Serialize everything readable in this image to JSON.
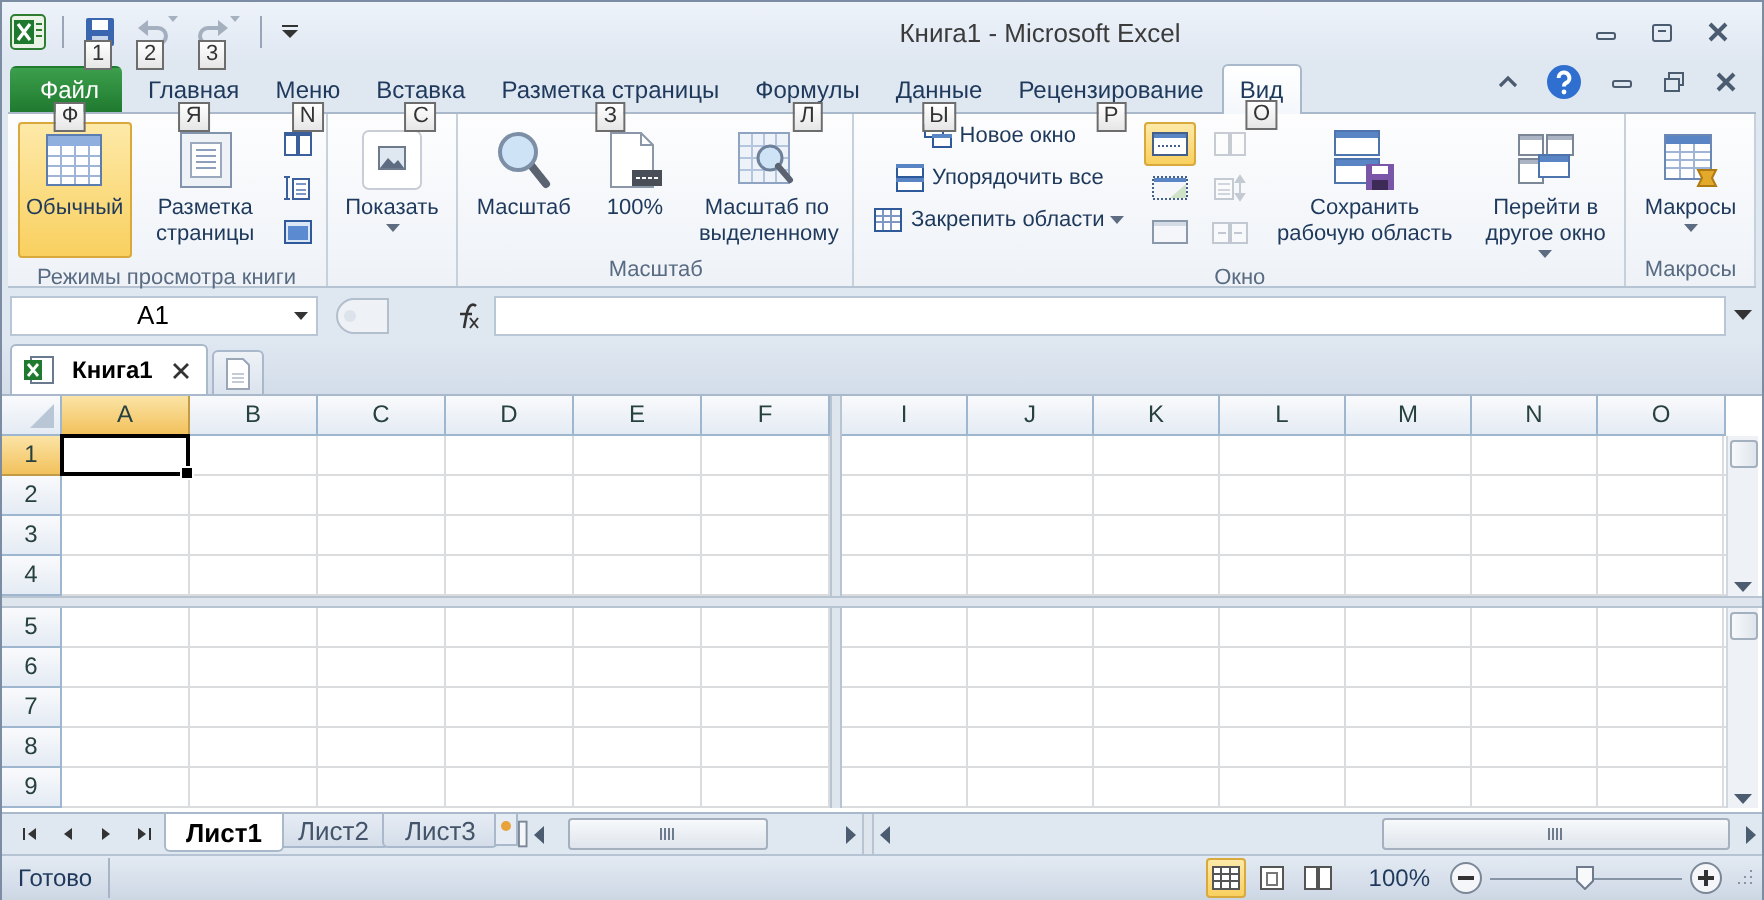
{
  "window": {
    "title": "Книга1 - Microsoft Excel"
  },
  "quick_access": [
    {
      "kind": "save",
      "key_tip": "1",
      "disabled": false
    },
    {
      "kind": "undo",
      "key_tip": "2",
      "disabled": true
    },
    {
      "kind": "redo",
      "key_tip": "3",
      "disabled": true
    }
  ],
  "tabs": [
    {
      "label": "Файл",
      "kind": "file",
      "key_tip": "Ф",
      "selected": false
    },
    {
      "label": "Главная",
      "kind": "tab",
      "key_tip": "Я",
      "selected": false
    },
    {
      "label": "Меню",
      "kind": "tab",
      "key_tip": "N",
      "selected": false
    },
    {
      "label": "Вставка",
      "kind": "tab",
      "key_tip": "С",
      "selected": false
    },
    {
      "label": "Разметка страницы",
      "kind": "tab",
      "key_tip": "З",
      "selected": false
    },
    {
      "label": "Формулы",
      "kind": "tab",
      "key_tip": "Л",
      "selected": false
    },
    {
      "label": "Данные",
      "kind": "tab",
      "key_tip": "Ы",
      "selected": false
    },
    {
      "label": "Рецензирование",
      "kind": "tab",
      "key_tip": "Р",
      "selected": false
    },
    {
      "label": "Вид",
      "kind": "tab",
      "key_tip": "О",
      "selected": true
    }
  ],
  "ribbon": {
    "groups": [
      {
        "label": "Режимы просмотра книги",
        "columns": [
          {
            "kind": "large",
            "items": [
              {
                "kind": "normal",
                "label": "Обычный",
                "selected": true
              }
            ]
          },
          {
            "kind": "large",
            "items": [
              {
                "kind": "layout",
                "label": "Разметка страницы",
                "selected": false
              }
            ]
          },
          {
            "kind": "icons",
            "items": [
              {
                "kind": "pagebreak",
                "selected": false
              },
              {
                "kind": "customviews",
                "selected": false
              },
              {
                "kind": "fullscreen",
                "selected": false
              }
            ]
          }
        ]
      },
      {
        "columns": [
          {
            "kind": "large",
            "items": [
              {
                "kind": "show",
                "label": "Показать",
                "dropdown": true
              }
            ]
          }
        ]
      },
      {
        "label": "Масштаб",
        "columns": [
          {
            "kind": "large",
            "items": [
              {
                "kind": "zoom",
                "label": "Масштаб"
              }
            ]
          },
          {
            "kind": "large",
            "items": [
              {
                "kind": "zoom100",
                "label": "100%"
              }
            ]
          },
          {
            "kind": "large",
            "items": [
              {
                "kind": "zoomselection",
                "label": "Масштаб по выделенному"
              }
            ]
          }
        ]
      },
      {
        "label": "Окно",
        "columns": [
          {
            "kind": "small",
            "items": [
              {
                "kind": "newwindow",
                "label": "Новое окно"
              },
              {
                "kind": "arrange",
                "label": "Упорядочить все"
              },
              {
                "kind": "freeze",
                "label": "Закрепить области",
                "dropdown": true
              }
            ]
          },
          {
            "kind": "icons",
            "items": [
              {
                "kind": "split",
                "on": true
              },
              {
                "kind": "hide",
                "on": false
              },
              {
                "kind": "unhide",
                "on": false
              }
            ]
          },
          {
            "kind": "icons",
            "items": [
              {
                "kind": "sidebyside",
                "disabled": true
              },
              {
                "kind": "syncscroll",
                "disabled": true
              },
              {
                "kind": "resetposition",
                "disabled": true
              }
            ]
          },
          {
            "kind": "large",
            "items": [
              {
                "kind": "workspace",
                "label": "Сохранить рабочую область"
              }
            ]
          },
          {
            "kind": "large",
            "items": [
              {
                "kind": "switchwindows",
                "label": "Перейти в другое окно",
                "dropdown": true
              }
            ]
          }
        ]
      },
      {
        "label": "Макросы",
        "columns": [
          {
            "kind": "large",
            "items": [
              {
                "kind": "macros",
                "label": "Макросы",
                "dropdown": true
              }
            ]
          }
        ]
      }
    ]
  },
  "formula_bar": {
    "name_box": "A1"
  },
  "workbook_tab": {
    "label": "Книга1"
  },
  "grid": {
    "columns_left": [
      {
        "label": "A",
        "selected": true
      },
      {
        "label": "B",
        "selected": false
      },
      {
        "label": "C",
        "selected": false
      },
      {
        "label": "D",
        "selected": false
      },
      {
        "label": "E",
        "selected": false
      },
      {
        "label": "F",
        "selected": false
      }
    ],
    "columns_right": [
      {
        "label": "I",
        "selected": false
      },
      {
        "label": "J",
        "selected": false
      },
      {
        "label": "K",
        "selected": false
      },
      {
        "label": "L",
        "selected": false
      },
      {
        "label": "M",
        "selected": false
      },
      {
        "label": "N",
        "selected": false
      },
      {
        "label": "O",
        "selected": false
      }
    ],
    "rows_top": [
      {
        "label": "1",
        "selected": true
      },
      {
        "label": "2",
        "selected": false
      },
      {
        "label": "3",
        "selected": false
      },
      {
        "label": "4",
        "selected": false
      }
    ],
    "rows_bottom": [
      {
        "label": "5",
        "selected": false
      },
      {
        "label": "6",
        "selected": false
      },
      {
        "label": "7",
        "selected": false
      },
      {
        "label": "8",
        "selected": false
      },
      {
        "label": "9",
        "selected": false
      }
    ]
  },
  "sheet_tabs": [
    {
      "label": "Лист1",
      "selected": true
    },
    {
      "label": "Лист2",
      "selected": false
    },
    {
      "label": "Лист3",
      "selected": false
    }
  ],
  "status_bar": {
    "text": "Готово",
    "views": [
      {
        "kind": "normal",
        "selected": true
      },
      {
        "kind": "layout",
        "selected": false
      },
      {
        "kind": "pagebreak",
        "selected": false
      }
    ],
    "zoom": "100%",
    "zoom_slider": {
      "level": 0.5
    }
  }
}
